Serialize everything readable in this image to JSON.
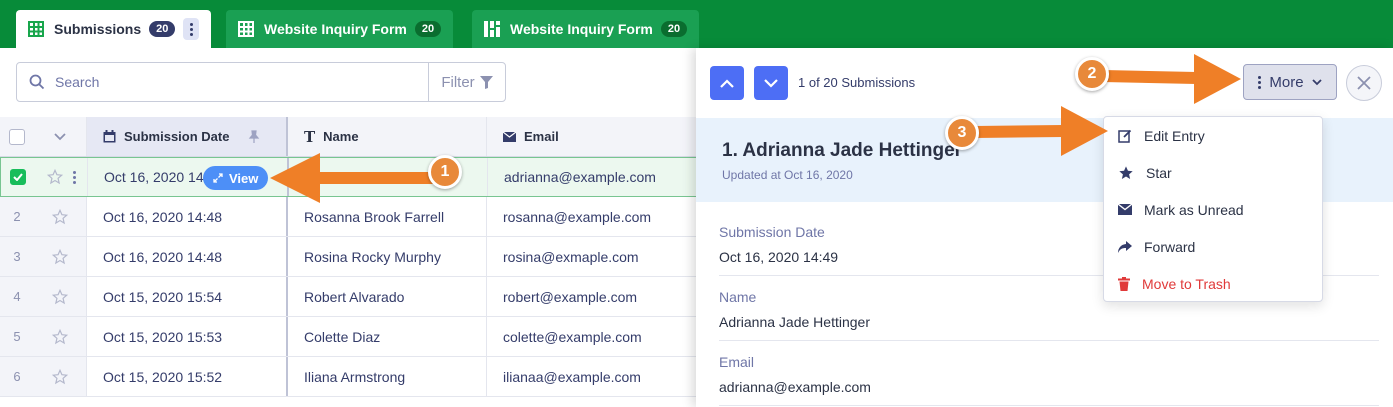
{
  "tabs": [
    {
      "label": "Submissions",
      "count": "20"
    },
    {
      "label": "Website Inquiry Form",
      "count": "20"
    },
    {
      "label": "Website Inquiry Form",
      "count": "20"
    }
  ],
  "toolbar": {
    "search_placeholder": "Search",
    "filter_label": "Filter"
  },
  "table": {
    "columns": [
      "Submission Date",
      "Name",
      "Email"
    ],
    "view_label": "View",
    "rows": [
      {
        "num": "1",
        "date": "Oct 16, 2020 14:49",
        "name": "Adrianna Jade Hettinger",
        "email": "adrianna@example.com",
        "selected": true
      },
      {
        "num": "2",
        "date": "Oct 16, 2020 14:48",
        "name": "Rosanna Brook Farrell",
        "email": "rosanna@example.com"
      },
      {
        "num": "3",
        "date": "Oct 16, 2020 14:48",
        "name": "Rosina Rocky Murphy",
        "email": "rosina@exmaple.com"
      },
      {
        "num": "4",
        "date": "Oct 15, 2020 15:54",
        "name": "Robert Alvarado",
        "email": "robert@example.com"
      },
      {
        "num": "5",
        "date": "Oct 15, 2020 15:53",
        "name": "Colette Diaz",
        "email": "colette@example.com"
      },
      {
        "num": "6",
        "date": "Oct 15, 2020 15:52",
        "name": "Iliana Armstrong",
        "email": "ilianaa@example.com"
      }
    ]
  },
  "panel": {
    "counter": "1 of 20 Submissions",
    "more_label": "More",
    "entry_title": "1. Adrianna Jade Hettinger",
    "entry_updated": "Updated at Oct 16, 2020",
    "fields": [
      {
        "label": "Submission Date",
        "value": "Oct 16, 2020 14:49"
      },
      {
        "label": "Name",
        "value": "Adrianna Jade Hettinger"
      },
      {
        "label": "Email",
        "value": "adrianna@example.com"
      }
    ]
  },
  "menu": {
    "items": [
      "Edit Entry",
      "Star",
      "Mark as Unread",
      "Forward",
      "Move to Trash"
    ]
  },
  "annotations": {
    "badges": [
      "1",
      "2",
      "3"
    ]
  },
  "colors": {
    "brand_green": "#078b39",
    "accent_blue": "#4d6ef5",
    "annotation_orange": "#e8893a",
    "danger_red": "#e03a3a"
  }
}
